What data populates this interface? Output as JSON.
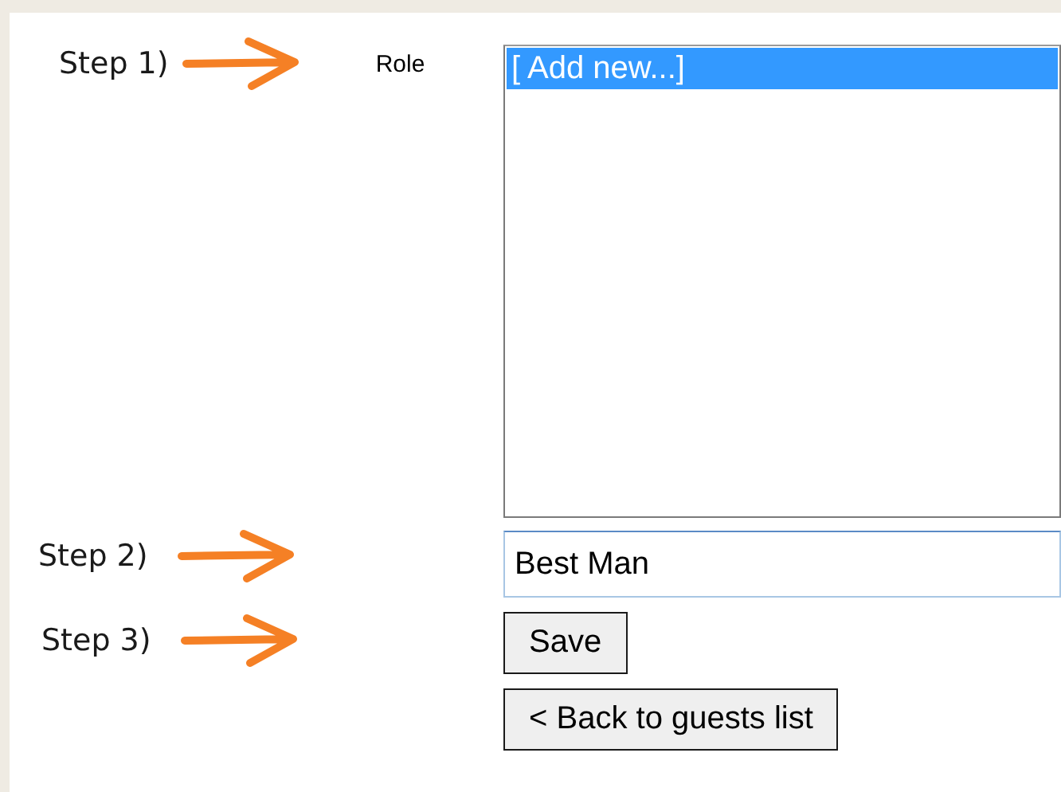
{
  "steps": [
    {
      "label": "Step 1)"
    },
    {
      "label": "Step 2)"
    },
    {
      "label": "Step 3)"
    }
  ],
  "role": {
    "label": "Role",
    "options": [
      {
        "text": "[ Add new...]",
        "selected": true
      }
    ]
  },
  "name_field": {
    "value": "Best Man"
  },
  "buttons": [
    {
      "label": "Save"
    },
    {
      "label": "< Back to guests list"
    }
  ]
}
